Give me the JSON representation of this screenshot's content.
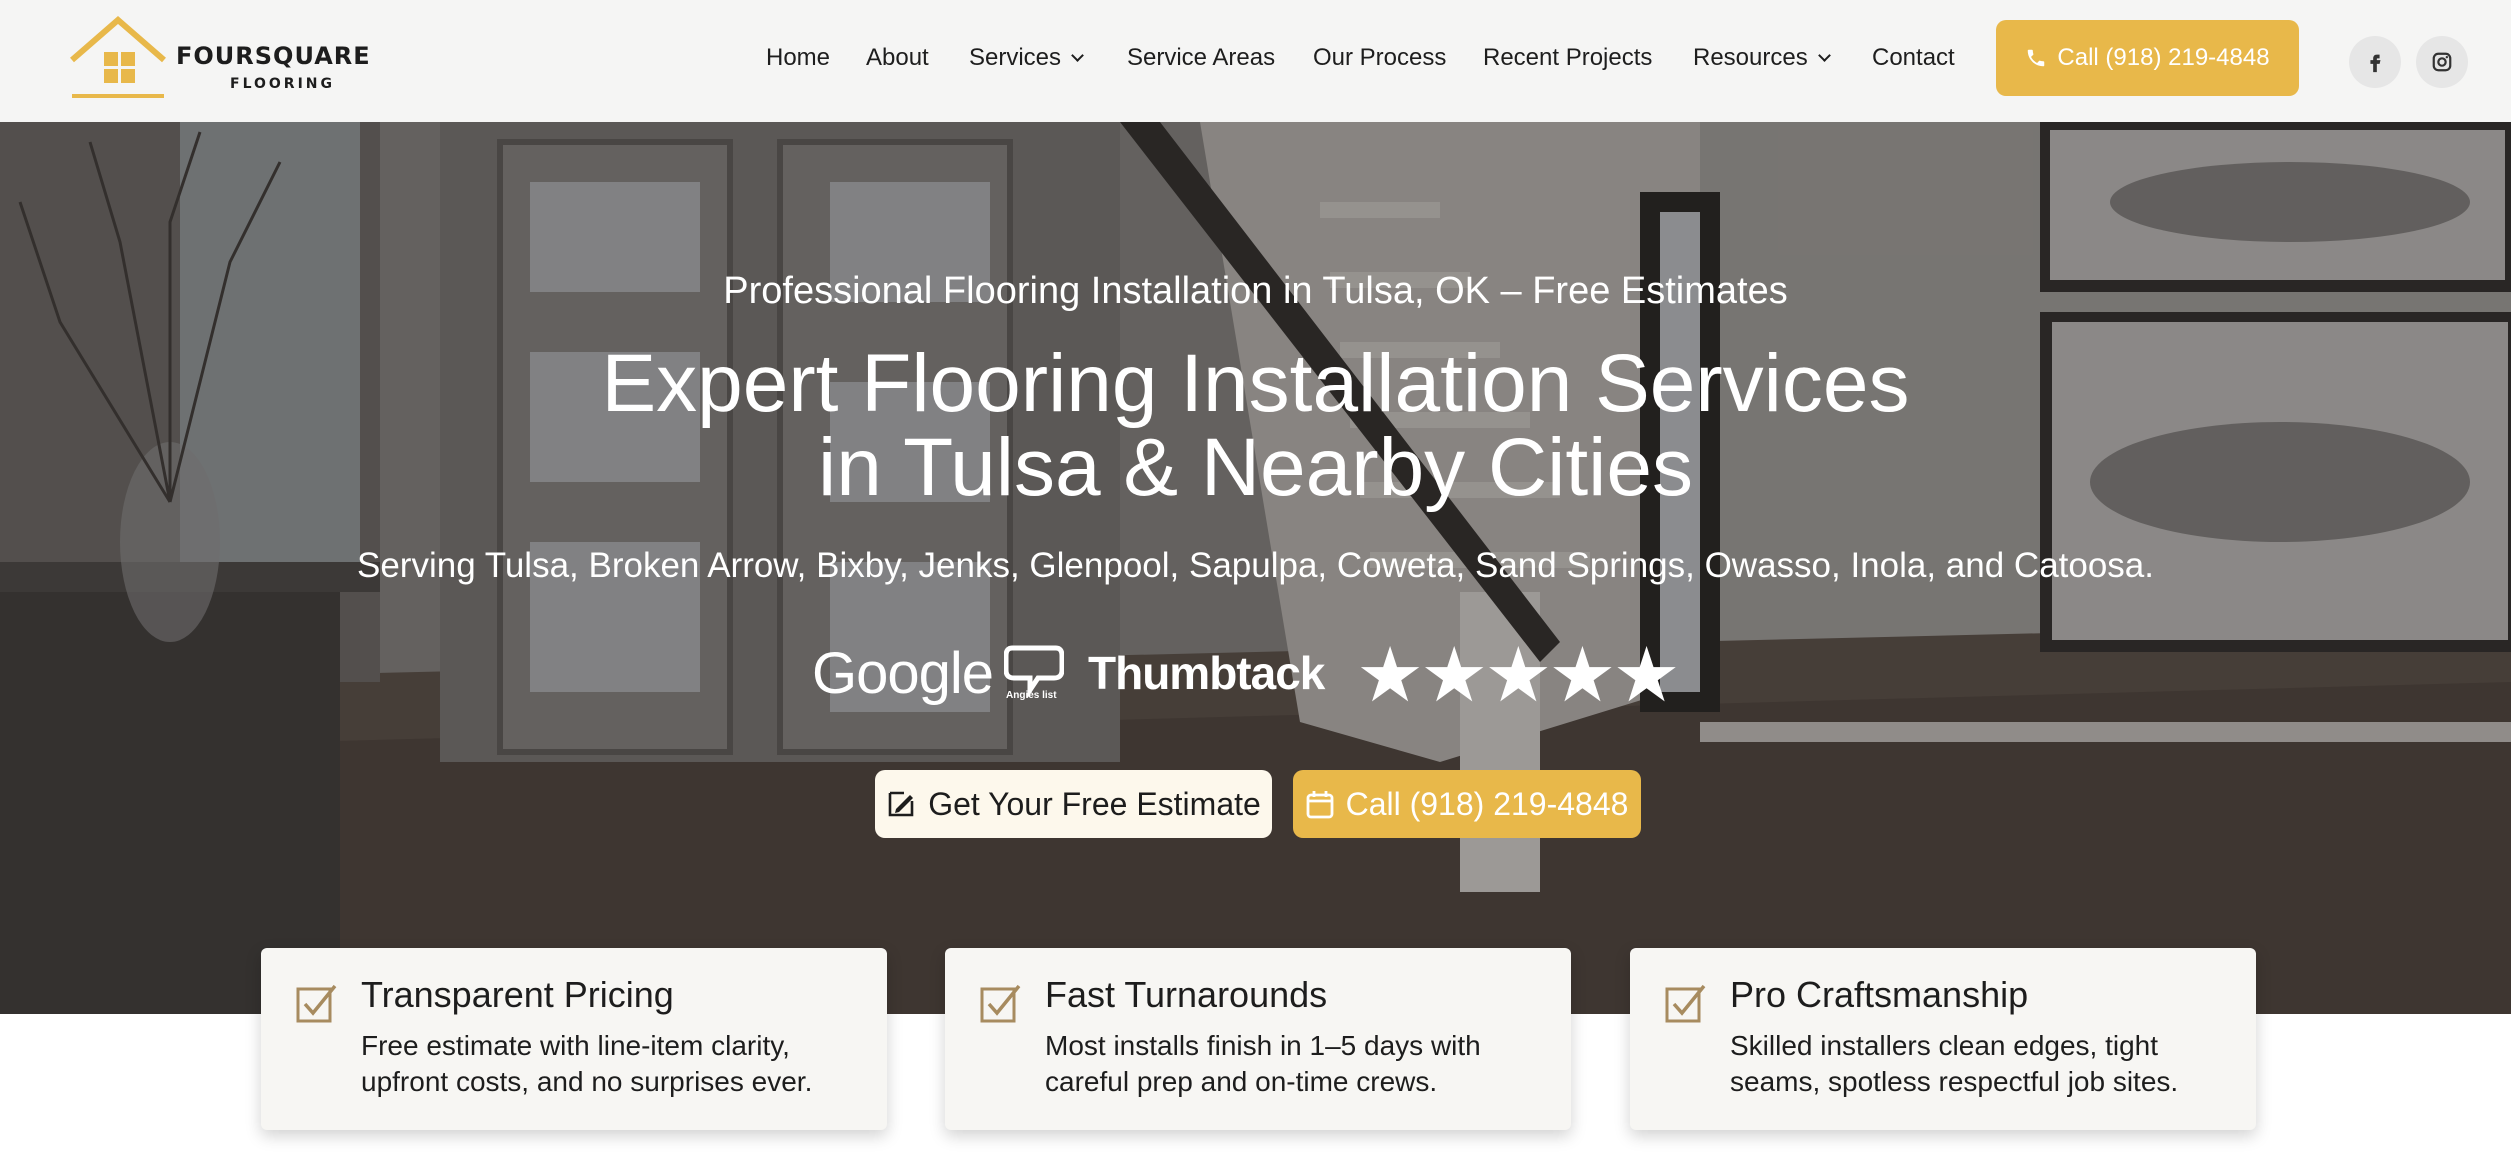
{
  "brand": {
    "name": "FOURSQUARE",
    "sub": "FLOORING",
    "accent": "#e8b84a"
  },
  "nav": {
    "items": [
      {
        "label": "Home"
      },
      {
        "label": "About"
      },
      {
        "label": "Services",
        "dropdown": true
      },
      {
        "label": "Service Areas"
      },
      {
        "label": "Our Process"
      },
      {
        "label": "Recent Projects"
      },
      {
        "label": "Resources",
        "dropdown": true
      },
      {
        "label": "Contact"
      }
    ],
    "call_label": "Call (918) 219-4848",
    "social": [
      {
        "icon": "facebook-icon"
      },
      {
        "icon": "instagram-icon"
      }
    ]
  },
  "hero": {
    "subtitle": "Professional Flooring Installation in Tulsa, OK – Free Estimates",
    "title_line1": "Expert Flooring Installation Services",
    "title_line2": "in Tulsa & Nearby Cities",
    "cities": "Serving Tulsa, Broken Arrow, Bixby, Jenks, Glenpool, Sapulpa, Coweta, Sand Springs, Owasso, Inola, and Catoosa.",
    "badges": {
      "google": "Google",
      "angies": "Angies list",
      "thumbtack": "Thumbtack",
      "stars": "★★★★★",
      "rating": 5
    },
    "cta_estimate": "Get Your Free Estimate",
    "cta_call": "Call (918) 219-4848"
  },
  "features": [
    {
      "title": "Transparent Pricing",
      "desc": "Free estimate with line-item clarity, upfront costs, and no surprises ever."
    },
    {
      "title": "Fast Turnarounds",
      "desc": "Most installs finish in 1–5 days with careful prep and on-time crews."
    },
    {
      "title": "Pro Craftsmanship",
      "desc": "Skilled installers clean edges, tight seams, spotless respectful job sites."
    }
  ]
}
